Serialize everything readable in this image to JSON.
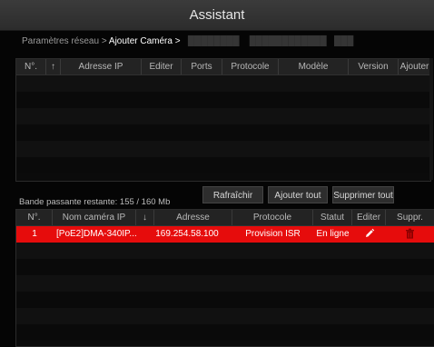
{
  "window": {
    "title": "Assistant"
  },
  "breadcrumb": {
    "step1": "Paramètres réseau >",
    "step2": "Ajouter Caméra >"
  },
  "search_table": {
    "columns": [
      "N°.",
      "↑",
      "Adresse IP",
      "Editer",
      "Ports",
      "Protocole",
      "Modèle",
      "Version",
      "Ajouter"
    ]
  },
  "bandwidth": {
    "label": "Bande passante restante: 155 / 160 Mb"
  },
  "buttons": {
    "refresh": "Rafraîchir",
    "add_all": "Ajouter tout",
    "delete_all": "Supprimer tout"
  },
  "added_table": {
    "columns": [
      "N°.",
      "Nom caméra IP",
      "↓",
      "Adresse",
      "Protocole",
      "Statut",
      "Editer",
      "Suppr."
    ],
    "rows": [
      {
        "no": "1",
        "name": "[PoE2]DMA-340IP...",
        "address": "169.254.58.100",
        "protocol": "Provision ISR",
        "status": "En ligne"
      }
    ]
  },
  "colors": {
    "selected_row": "#e60c0c",
    "background": "#050505"
  }
}
